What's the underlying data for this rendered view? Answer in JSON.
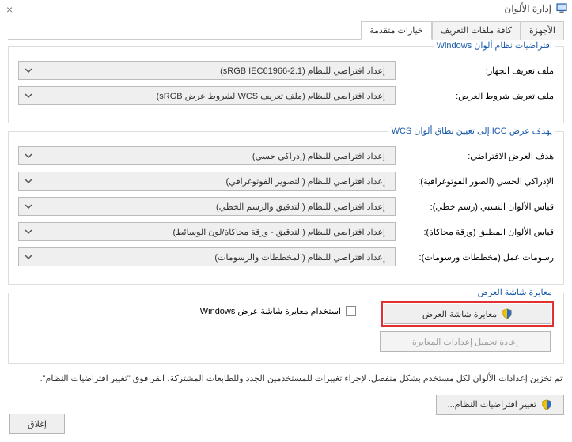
{
  "window": {
    "title": "إدارة الألوان"
  },
  "tabs": {
    "devices": "الأجهزة",
    "all_profiles": "كافة ملفات التعريف",
    "advanced": "خيارات متقدمة"
  },
  "defaults_group": {
    "title": "افتراضيات نظام ألوان Windows",
    "device_profile_label": "ملف تعريف الجهاز:",
    "device_profile_value": "إعداد افتراضي للنظام (sRGB IEC61966-2.1)",
    "viewing_profile_label": "ملف تعريف شروط العرض:",
    "viewing_profile_value": "إعداد افتراضي للنظام (ملف تعريف WCS لشروط عرض sRGB)"
  },
  "wcs_group": {
    "title": "يهدف عرض ICC إلى تعيين نطاق ألوان WCS",
    "default_intent_label": "هدف العرض الافتراضي:",
    "default_intent_value": "إعداد افتراضي للنظام (إدراكي حسي)",
    "perceptual_label": "الإدراكي الحسي (الصور الفوتوغرافية):",
    "perceptual_value": "إعداد افتراضي للنظام (التصوير الفوتوغرافي)",
    "relative_label": "قياس الألوان النسبي (رسم خطي):",
    "relative_value": "إعداد افتراضي للنظام (التدقيق والرسم الخطي)",
    "absolute_label": "قياس الألوان المطلق (ورقة محاكاة):",
    "absolute_value": "إعداد افتراضي للنظام (التدقيق - ورقة محاكاة/لون الوسائط)",
    "business_label": "رسومات عمل (مخططات ورسومات):",
    "business_value": "إعداد افتراضي للنظام (المخططات والرسومات)"
  },
  "calibration_group": {
    "title": "معايرة شاشة العرض",
    "calibrate_btn": "معايرة شاشة العرض",
    "use_windows_cal": "استخدام معايرة شاشة عرض Windows",
    "reload_btn": "إعادة تحميل إعدادات المعايرة"
  },
  "info_text": "تم تخزين إعدادات الألوان لكل مستخدم بشكل منفصل. لإجراء تغييرات للمستخدمين الجدد وللطابعات المشتركة، انقر فوق \"تغيير افتراضيات النظام\".",
  "change_defaults_btn": "تغيير افتراضيات النظام...",
  "close_btn": "إغلاق"
}
